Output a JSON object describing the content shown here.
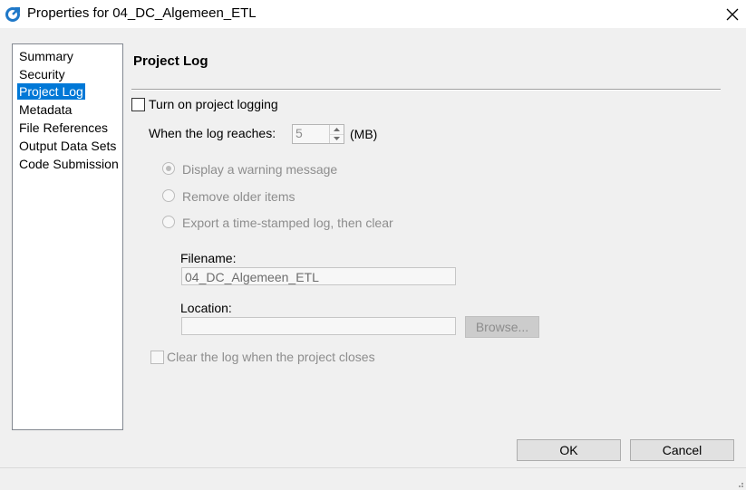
{
  "window": {
    "title": "Properties for 04_DC_Algemeen_ETL",
    "app_icon": "app-logo-icon",
    "close_icon": "close-icon"
  },
  "nav": {
    "items": [
      {
        "label": "Summary"
      },
      {
        "label": "Security"
      },
      {
        "label": "Project Log"
      },
      {
        "label": "Metadata"
      },
      {
        "label": "File References"
      },
      {
        "label": "Output Data Sets"
      },
      {
        "label": "Code Submission"
      }
    ],
    "selected": "Project Log"
  },
  "panel": {
    "title": "Project Log",
    "turn_on_logging_label": "Turn on project logging",
    "turn_on_logging_checked": false,
    "log_reaches_label": "When the log reaches:",
    "log_reaches_value": "5",
    "log_reaches_unit": "(MB)",
    "options": [
      {
        "label": "Display a warning message",
        "checked": true
      },
      {
        "label": "Remove older items",
        "checked": false
      },
      {
        "label": "Export a time-stamped log, then clear",
        "checked": false
      }
    ],
    "filename_label": "Filename:",
    "filename_value": "04_DC_Algemeen_ETL",
    "location_label": "Location:",
    "location_value": "",
    "browse_label": "Browse...",
    "clear_log_label": "Clear the log when the project closes",
    "clear_log_checked": false
  },
  "footer": {
    "ok_label": "OK",
    "cancel_label": "Cancel"
  },
  "colors": {
    "selection": "#0078d7",
    "background": "#f0f0f0",
    "disabled_text": "#8d8d8d"
  }
}
